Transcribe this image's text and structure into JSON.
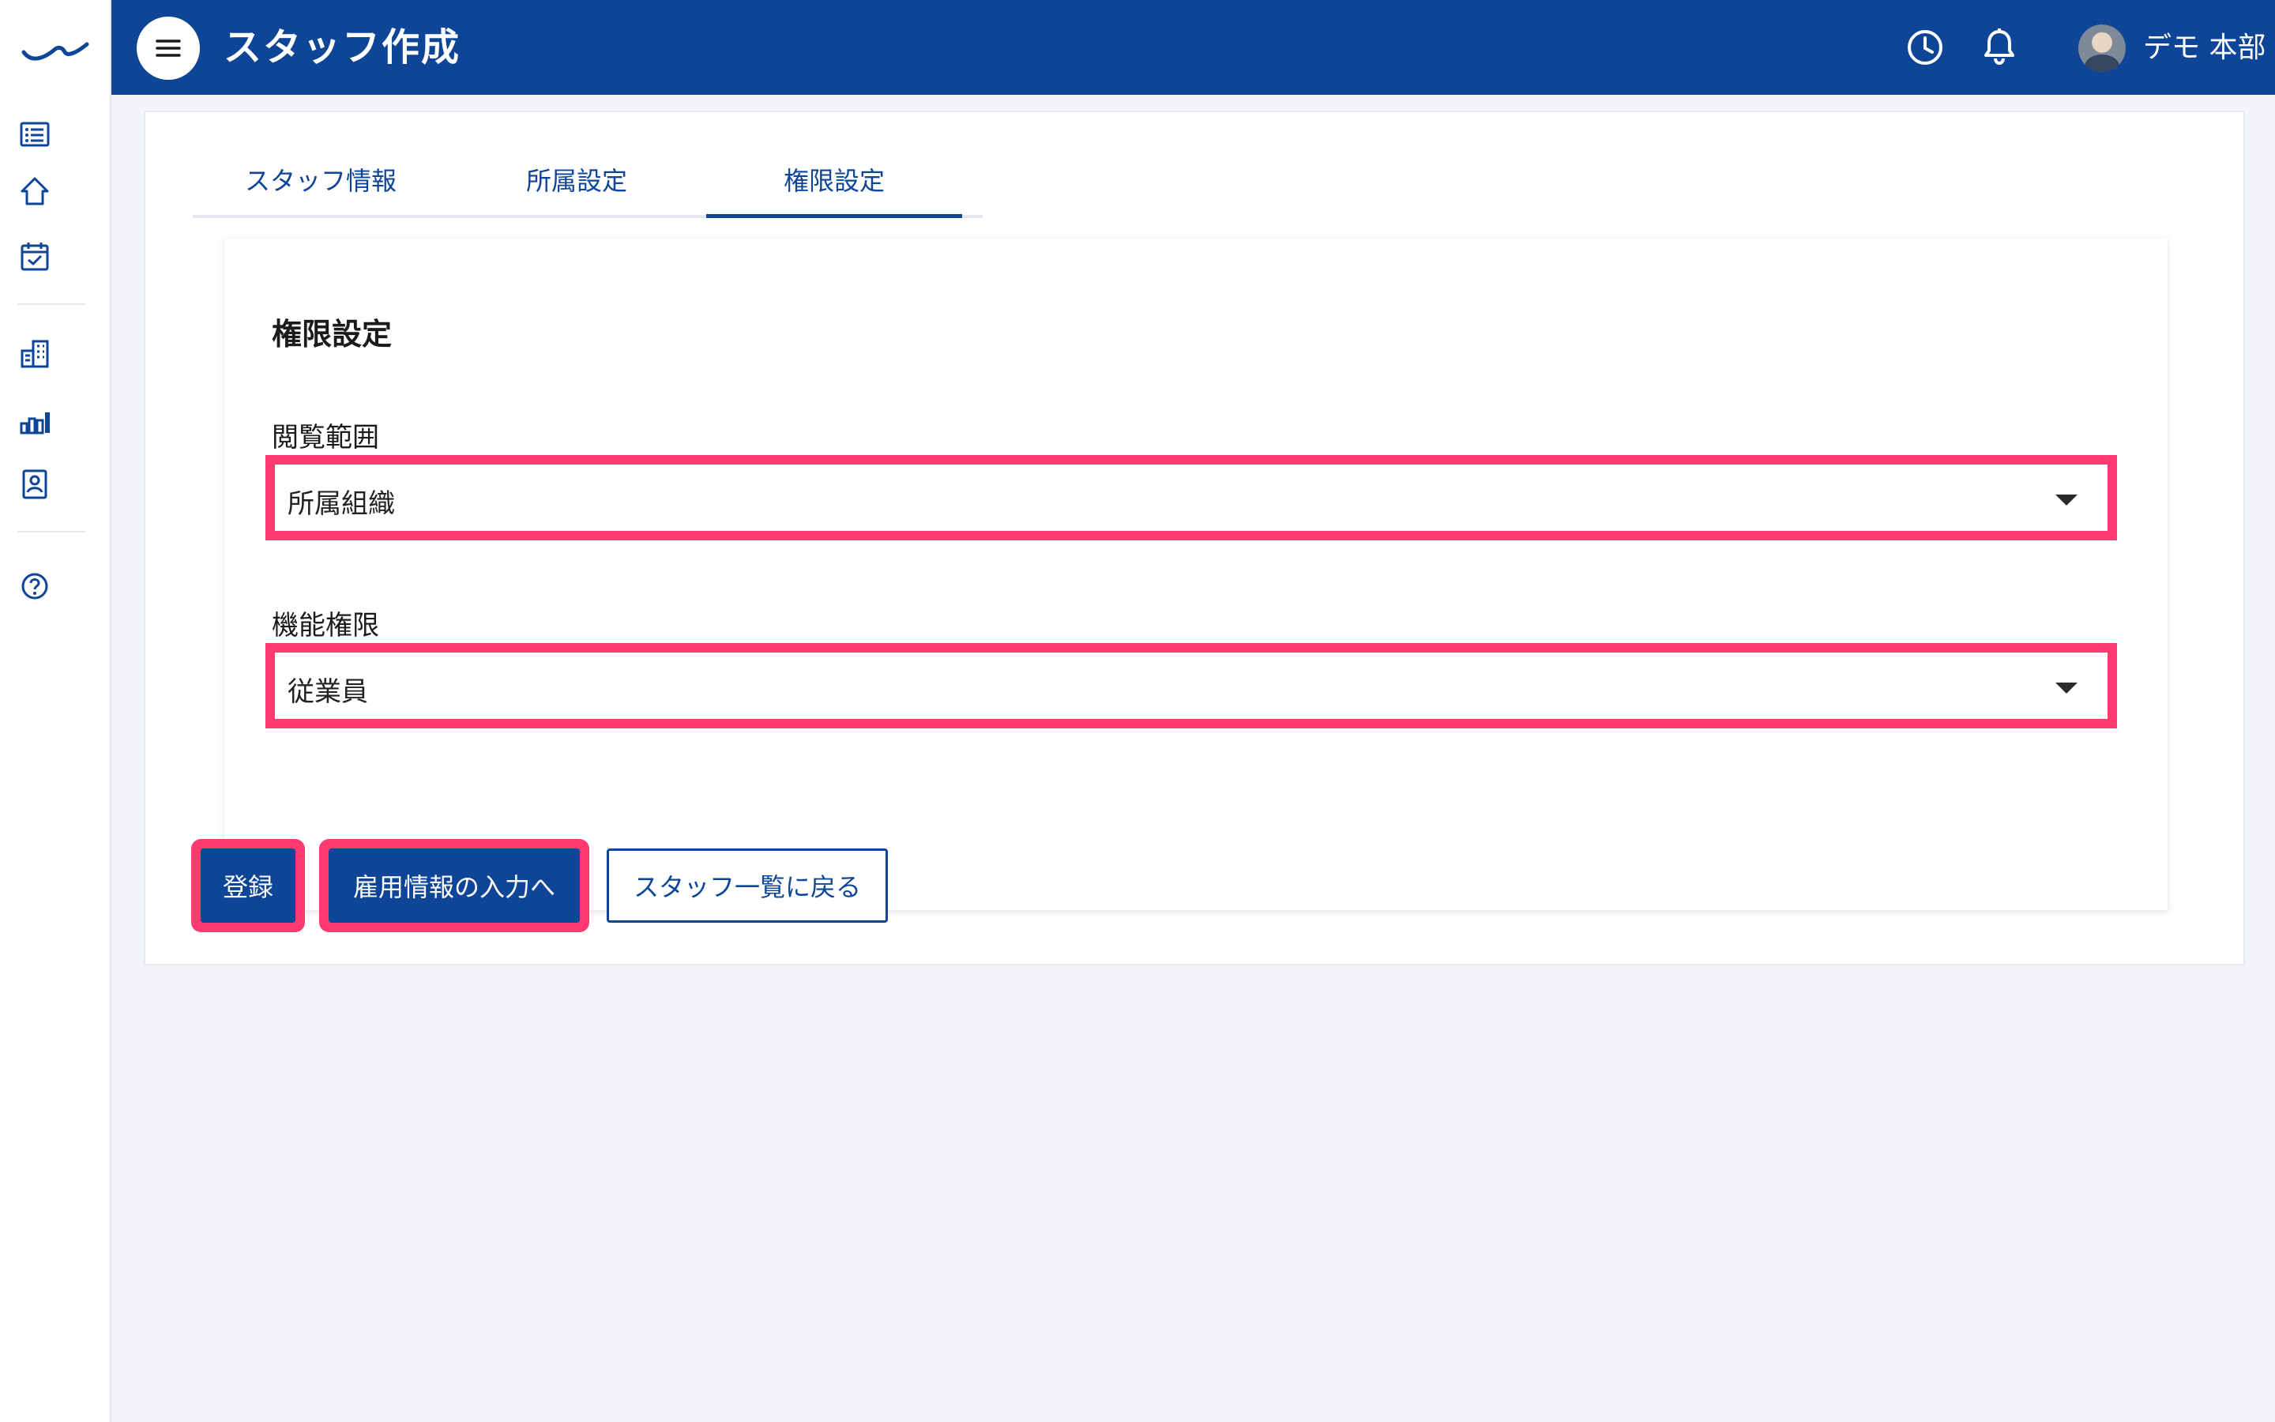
{
  "header": {
    "title": "スタッフ作成",
    "user_name": "デモ 本部"
  },
  "sidebar": {
    "icons": [
      "list-icon",
      "home-icon",
      "calendar-check-icon",
      "building-icon",
      "bar-chart-icon",
      "id-card-icon",
      "help-icon"
    ]
  },
  "tabs": [
    {
      "label": "スタッフ情報",
      "active": false
    },
    {
      "label": "所属設定",
      "active": false
    },
    {
      "label": "権限設定",
      "active": true
    }
  ],
  "panel": {
    "title": "権限設定",
    "fields": [
      {
        "label": "閲覧範囲",
        "value": "所属組織"
      },
      {
        "label": "機能権限",
        "value": "従業員"
      }
    ]
  },
  "buttons": {
    "register": "登録",
    "employment": "雇用情報の入力へ",
    "back": "スタッフ一覧に戻る"
  },
  "colors": {
    "brand": "#0e4597",
    "highlight": "#ff3a70"
  }
}
